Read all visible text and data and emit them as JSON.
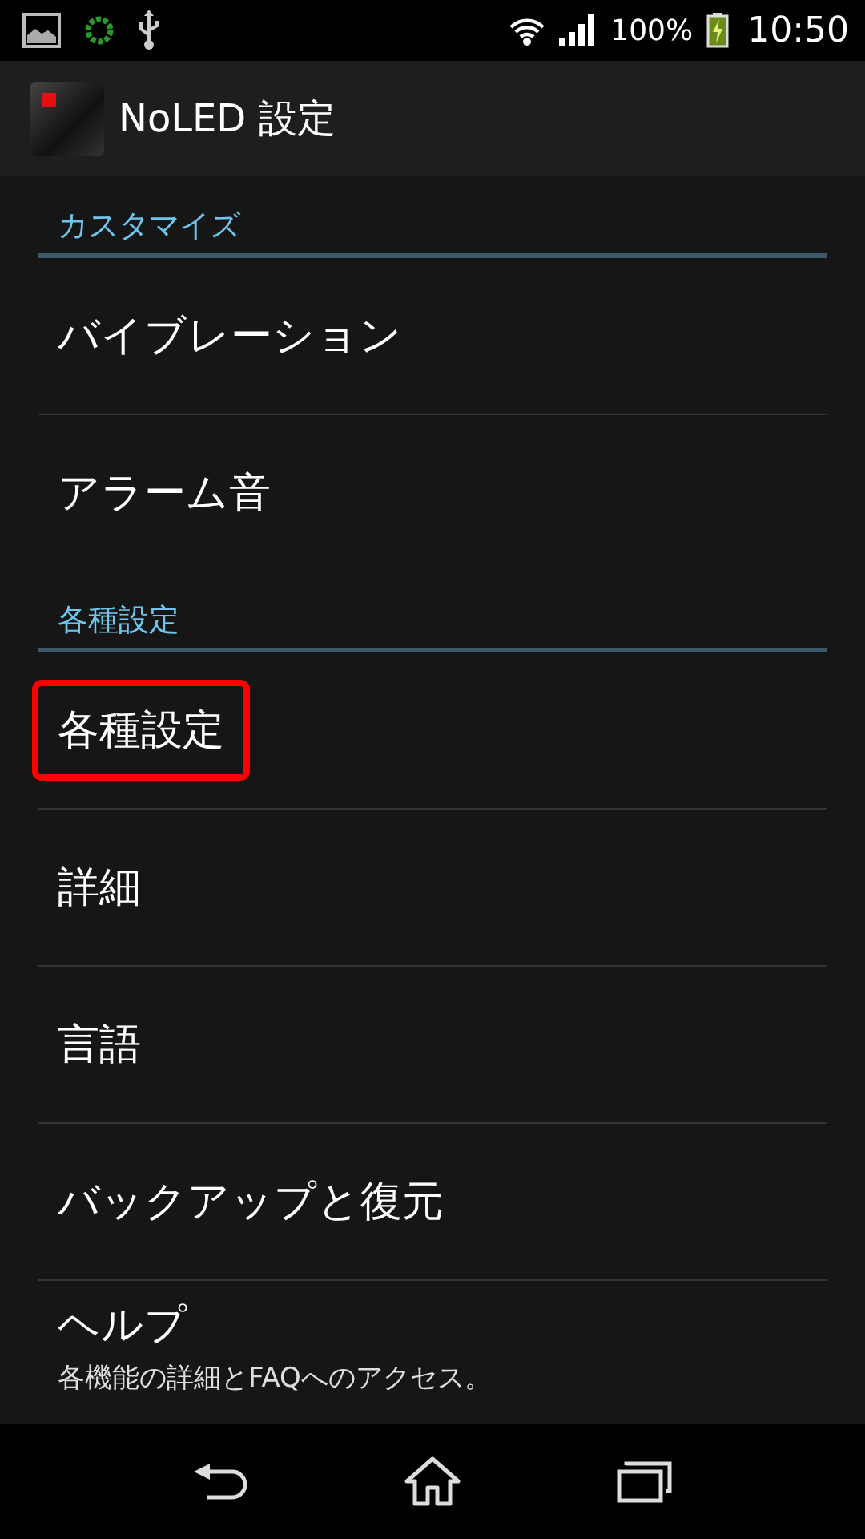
{
  "status_bar": {
    "battery": "100%",
    "time": "10:50"
  },
  "action_bar": {
    "title": "NoLED 設定"
  },
  "sections": [
    {
      "header": "カスタマイズ",
      "items": [
        {
          "title": "バイブレーション",
          "highlighted": false
        },
        {
          "title": "アラーム音",
          "highlighted": false
        }
      ]
    },
    {
      "header": "各種設定",
      "items": [
        {
          "title": "各種設定",
          "highlighted": true
        },
        {
          "title": "詳細",
          "highlighted": false
        },
        {
          "title": "言語",
          "highlighted": false
        },
        {
          "title": "バックアップと復元",
          "highlighted": false
        },
        {
          "title": "ヘルプ",
          "summary": "各機能の詳細とFAQへのアクセス。",
          "highlighted": false
        }
      ]
    }
  ]
}
